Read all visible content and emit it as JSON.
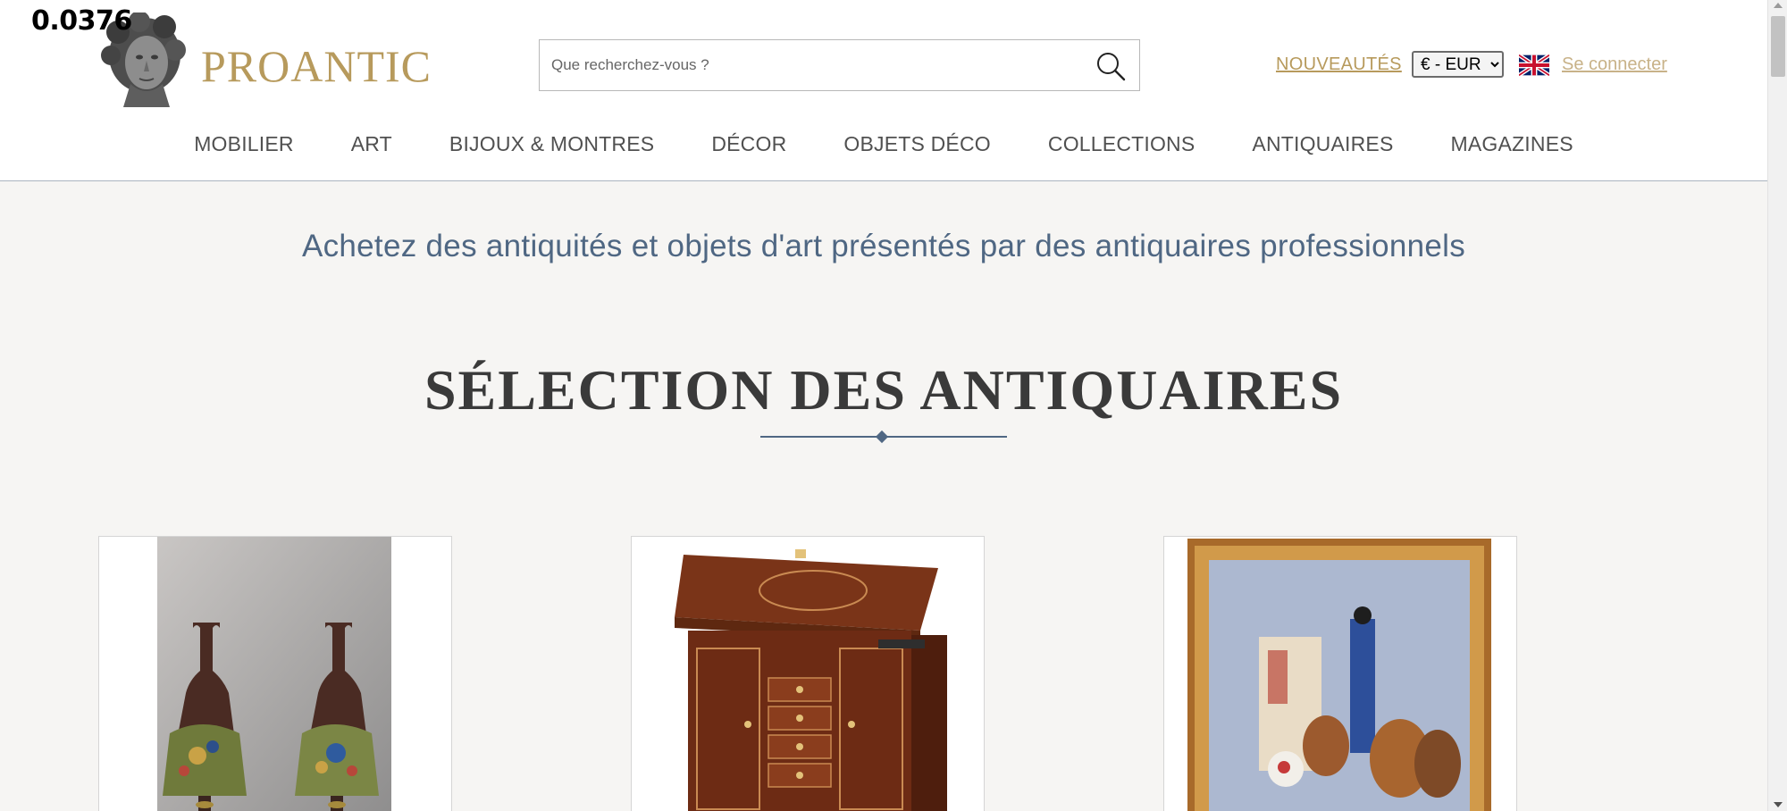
{
  "overlay": {
    "value": "0.0376"
  },
  "brand": {
    "name": "PROANTIC"
  },
  "search": {
    "placeholder": "Que recherchez-vous ?"
  },
  "header": {
    "new_label": "NOUVEAUTÉS",
    "currency_selected": "€ - EUR",
    "login_label": "Se connecter"
  },
  "nav": {
    "items": [
      {
        "label": "MOBILIER"
      },
      {
        "label": "ART"
      },
      {
        "label": "BIJOUX & MONTRES"
      },
      {
        "label": "DÉCOR"
      },
      {
        "label": "OBJETS DÉCO"
      },
      {
        "label": "COLLECTIONS"
      },
      {
        "label": "ANTIQUAIRES"
      },
      {
        "label": "MAGAZINES"
      }
    ]
  },
  "main": {
    "tagline": "Achetez des antiquités et objets d'art présentés par des antiquaires professionnels",
    "section_title": "SÉLECTION DES ANTIQUAIRES"
  },
  "icons": {
    "logo": "classical-bust-icon",
    "search": "search-icon",
    "flag": "uk-flag-icon"
  },
  "colors": {
    "gold": "#b79a5c",
    "slate_blue": "#4f6783",
    "background": "#f6f5f3"
  }
}
